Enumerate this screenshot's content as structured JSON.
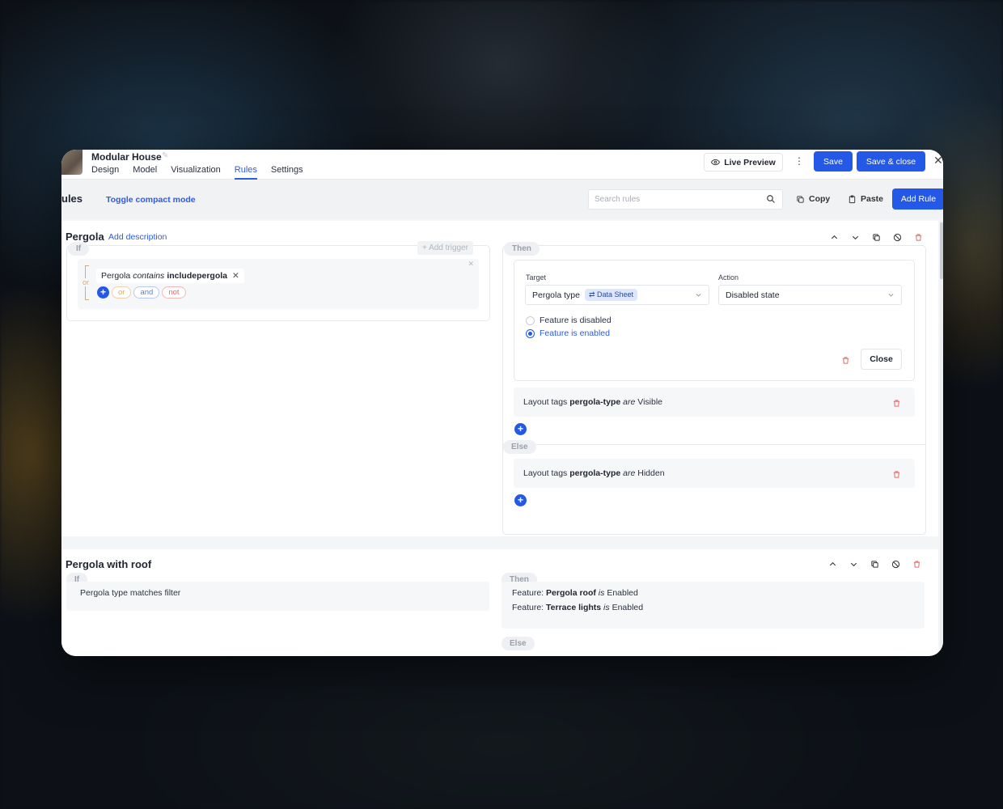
{
  "app": {
    "title": "Modular House"
  },
  "nav": {
    "tabs": [
      "Design",
      "Model",
      "Visualization",
      "Rules",
      "Settings"
    ],
    "active": "Rules"
  },
  "header": {
    "live_preview": "Live Preview",
    "save": "Save",
    "save_close": "Save & close"
  },
  "toolbar": {
    "heading": "ules",
    "toggle_compact": "Toggle compact mode",
    "search_placeholder": "Search rules",
    "copy": "Copy",
    "paste": "Paste",
    "add_rule": "Add Rule"
  },
  "rules": [
    {
      "title": "Pergola",
      "add_description": "Add description",
      "if_label": "If",
      "add_trigger": "+ Add trigger",
      "condition": {
        "subject": "Pergola",
        "operator": "contains",
        "value": "includepergola"
      },
      "logic": {
        "or_mini": "or",
        "or": "or",
        "and": "and",
        "not": "not"
      },
      "then_label": "Then",
      "target_label": "Target",
      "target_value": "Pergola type",
      "target_badge": "Data Sheet",
      "action_label": "Action",
      "action_value": "Disabled state",
      "radio_disabled": "Feature is disabled",
      "radio_enabled": "Feature is enabled",
      "close": "Close",
      "then_action": {
        "prefix": "Layout tags",
        "tag": "pergola-type",
        "verb": "are",
        "state": "Visible"
      },
      "else_label": "Else",
      "else_action": {
        "prefix": "Layout tags",
        "tag": "pergola-type",
        "verb": "are",
        "state": "Hidden"
      }
    },
    {
      "title": "Pergola with roof",
      "if_label": "If",
      "condition_text": "Pergola type matches filter",
      "then_label": "Then",
      "actions": [
        {
          "prefix": "Feature:",
          "name": "Pergola roof",
          "verb": "is",
          "state": "Enabled"
        },
        {
          "prefix": "Feature:",
          "name": "Terrace lights",
          "verb": "is",
          "state": "Enabled"
        }
      ],
      "else_label": "Else"
    }
  ],
  "colors": {
    "primary": "#2459e8",
    "link": "#2d5be3",
    "danger": "#e26b6b"
  }
}
